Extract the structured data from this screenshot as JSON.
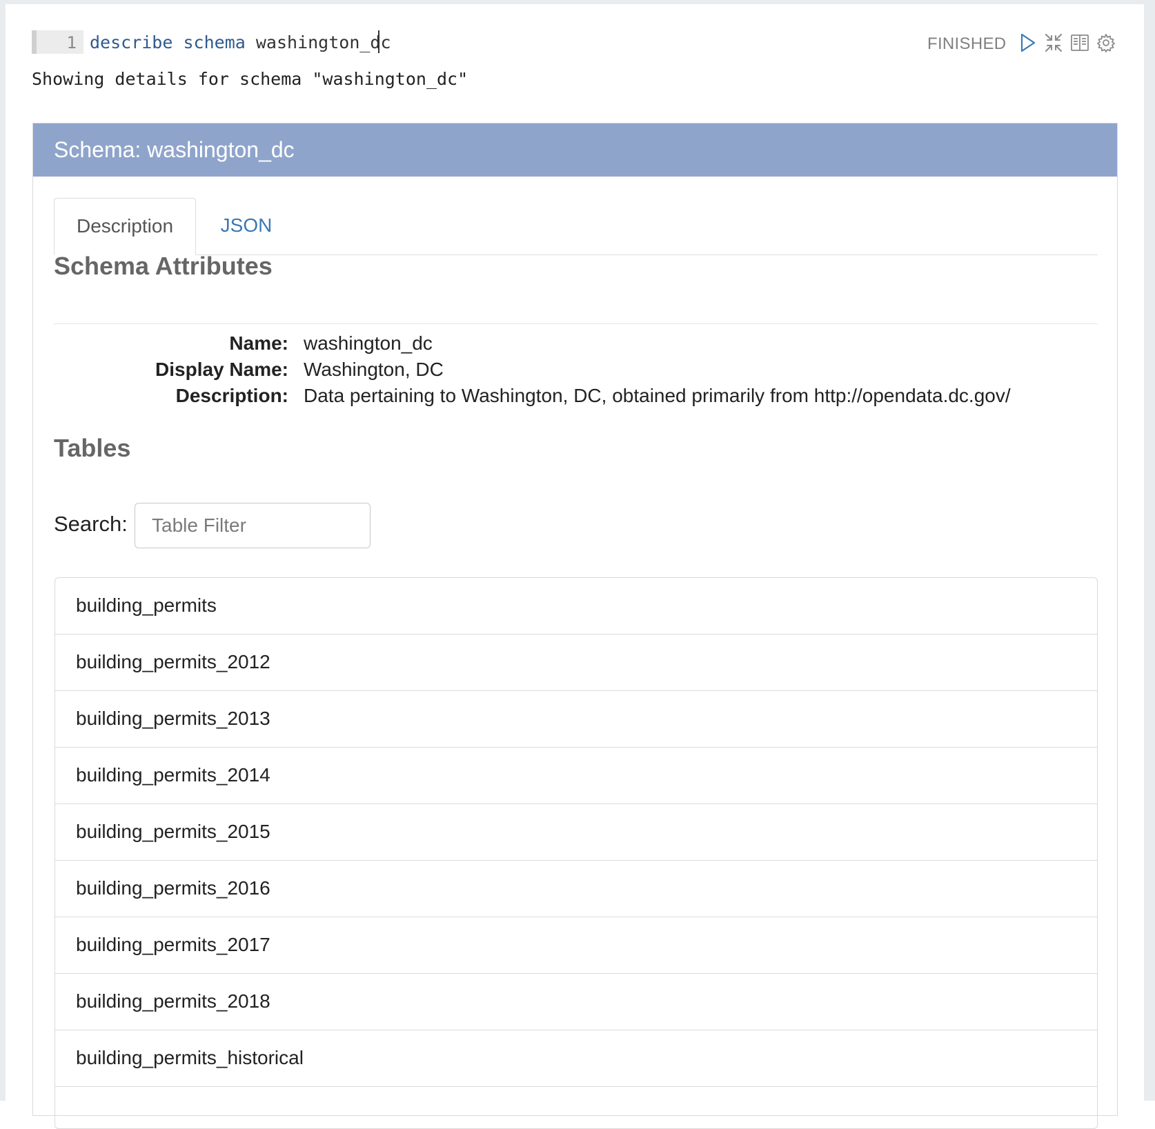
{
  "editor": {
    "line_number": "1",
    "code_keyword_1": "describe",
    "code_keyword_2": "schema",
    "code_arg": "washington_dc"
  },
  "output": {
    "message": "Showing details for schema \"washington_dc\""
  },
  "toolbar": {
    "status": "FINISHED",
    "icons": [
      "play-icon",
      "collapse-icon",
      "book-icon",
      "gear-icon"
    ],
    "accent_color": "#3a78b5"
  },
  "panel": {
    "title": "Schema: washington_dc",
    "heading_color": "#8fa4cb",
    "tabs": [
      {
        "label": "Description",
        "active": true
      },
      {
        "label": "JSON",
        "active": false
      }
    ],
    "attributes_title": "Schema Attributes",
    "attributes": [
      {
        "label": "Name:",
        "value": "washington_dc"
      },
      {
        "label": "Display Name:",
        "value": "Washington, DC"
      },
      {
        "label": "Description:",
        "value": "Data pertaining to Washington, DC, obtained primarily from http://opendata.dc.gov/"
      }
    ],
    "tables_title": "Tables",
    "search": {
      "label": "Search:",
      "placeholder": "Table Filter",
      "value": ""
    },
    "tables": [
      "building_permits",
      "building_permits_2012",
      "building_permits_2013",
      "building_permits_2014",
      "building_permits_2015",
      "building_permits_2016",
      "building_permits_2017",
      "building_permits_2018",
      "building_permits_historical"
    ]
  }
}
